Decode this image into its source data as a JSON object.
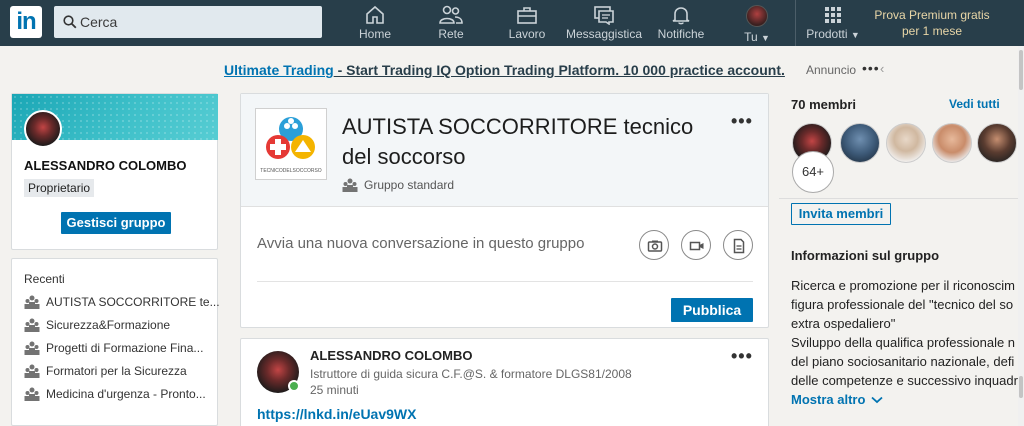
{
  "nav": {
    "logo": "in",
    "search_placeholder": "Cerca",
    "items": [
      {
        "label": "Home"
      },
      {
        "label": "Rete"
      },
      {
        "label": "Lavoro"
      },
      {
        "label": "Messaggistica"
      },
      {
        "label": "Notifiche"
      },
      {
        "label": "Tu"
      },
      {
        "label": "Prodotti"
      }
    ],
    "premium_line1": "Prova Premium gratis",
    "premium_line2": "per 1 mese"
  },
  "ad": {
    "link": "Ultimate Trading",
    "text": " - Start Trading IQ Option Trading Platform. 10 000 practice account.",
    "tag": "Annuncio",
    "more": "•••",
    "chevron": "‹"
  },
  "profile": {
    "name": "ALESSANDRO COLOMBO",
    "role": "Proprietario",
    "manage_button": "Gestisci gruppo"
  },
  "recent": {
    "title": "Recenti",
    "items": [
      "AUTISTA SOCCORRITORE te...",
      "Sicurezza&Formazione",
      "Progetti di Formazione Fina...",
      "Formatori per la Sicurezza",
      "Medicina d'urgenza - Pronto..."
    ]
  },
  "group": {
    "title": "AUTISTA SOCCORRITORE tecnico del soccorso",
    "logo_caption": "TECNICODELSOCCORSO",
    "type": "Gruppo standard",
    "composer_placeholder": "Avvia una nuova conversazione in questo gruppo",
    "publish_button": "Pubblica",
    "more": "•••"
  },
  "post": {
    "author": "ALESSANDRO COLOMBO",
    "headline": "Istruttore di guida sicura C.F.@S. & formatore DLGS81/2008",
    "time": "25 minuti",
    "link": "https://lnkd.in/eUav9WX",
    "more": "•••"
  },
  "members": {
    "title": "70 membri",
    "see_all": "Vedi tutti",
    "extra_count": "64+",
    "invite_button": "Invita membri"
  },
  "info": {
    "title": "Informazioni sul gruppo",
    "lines": [
      "Ricerca e promozione per il riconoscim",
      "figura professionale del \"tecnico del so",
      "extra ospedaliero\"",
      "Sviluppo della qualifica professionale n",
      "del piano sociosanitario nazionale, defi",
      "delle competenze e successivo inquadr"
    ],
    "show_more": "Mostra altro"
  },
  "colors": {
    "nav_bg": "#283e4a",
    "accent": "#0073b1",
    "premium": "#e8d6a7",
    "page_bg": "#f3f2ef"
  }
}
